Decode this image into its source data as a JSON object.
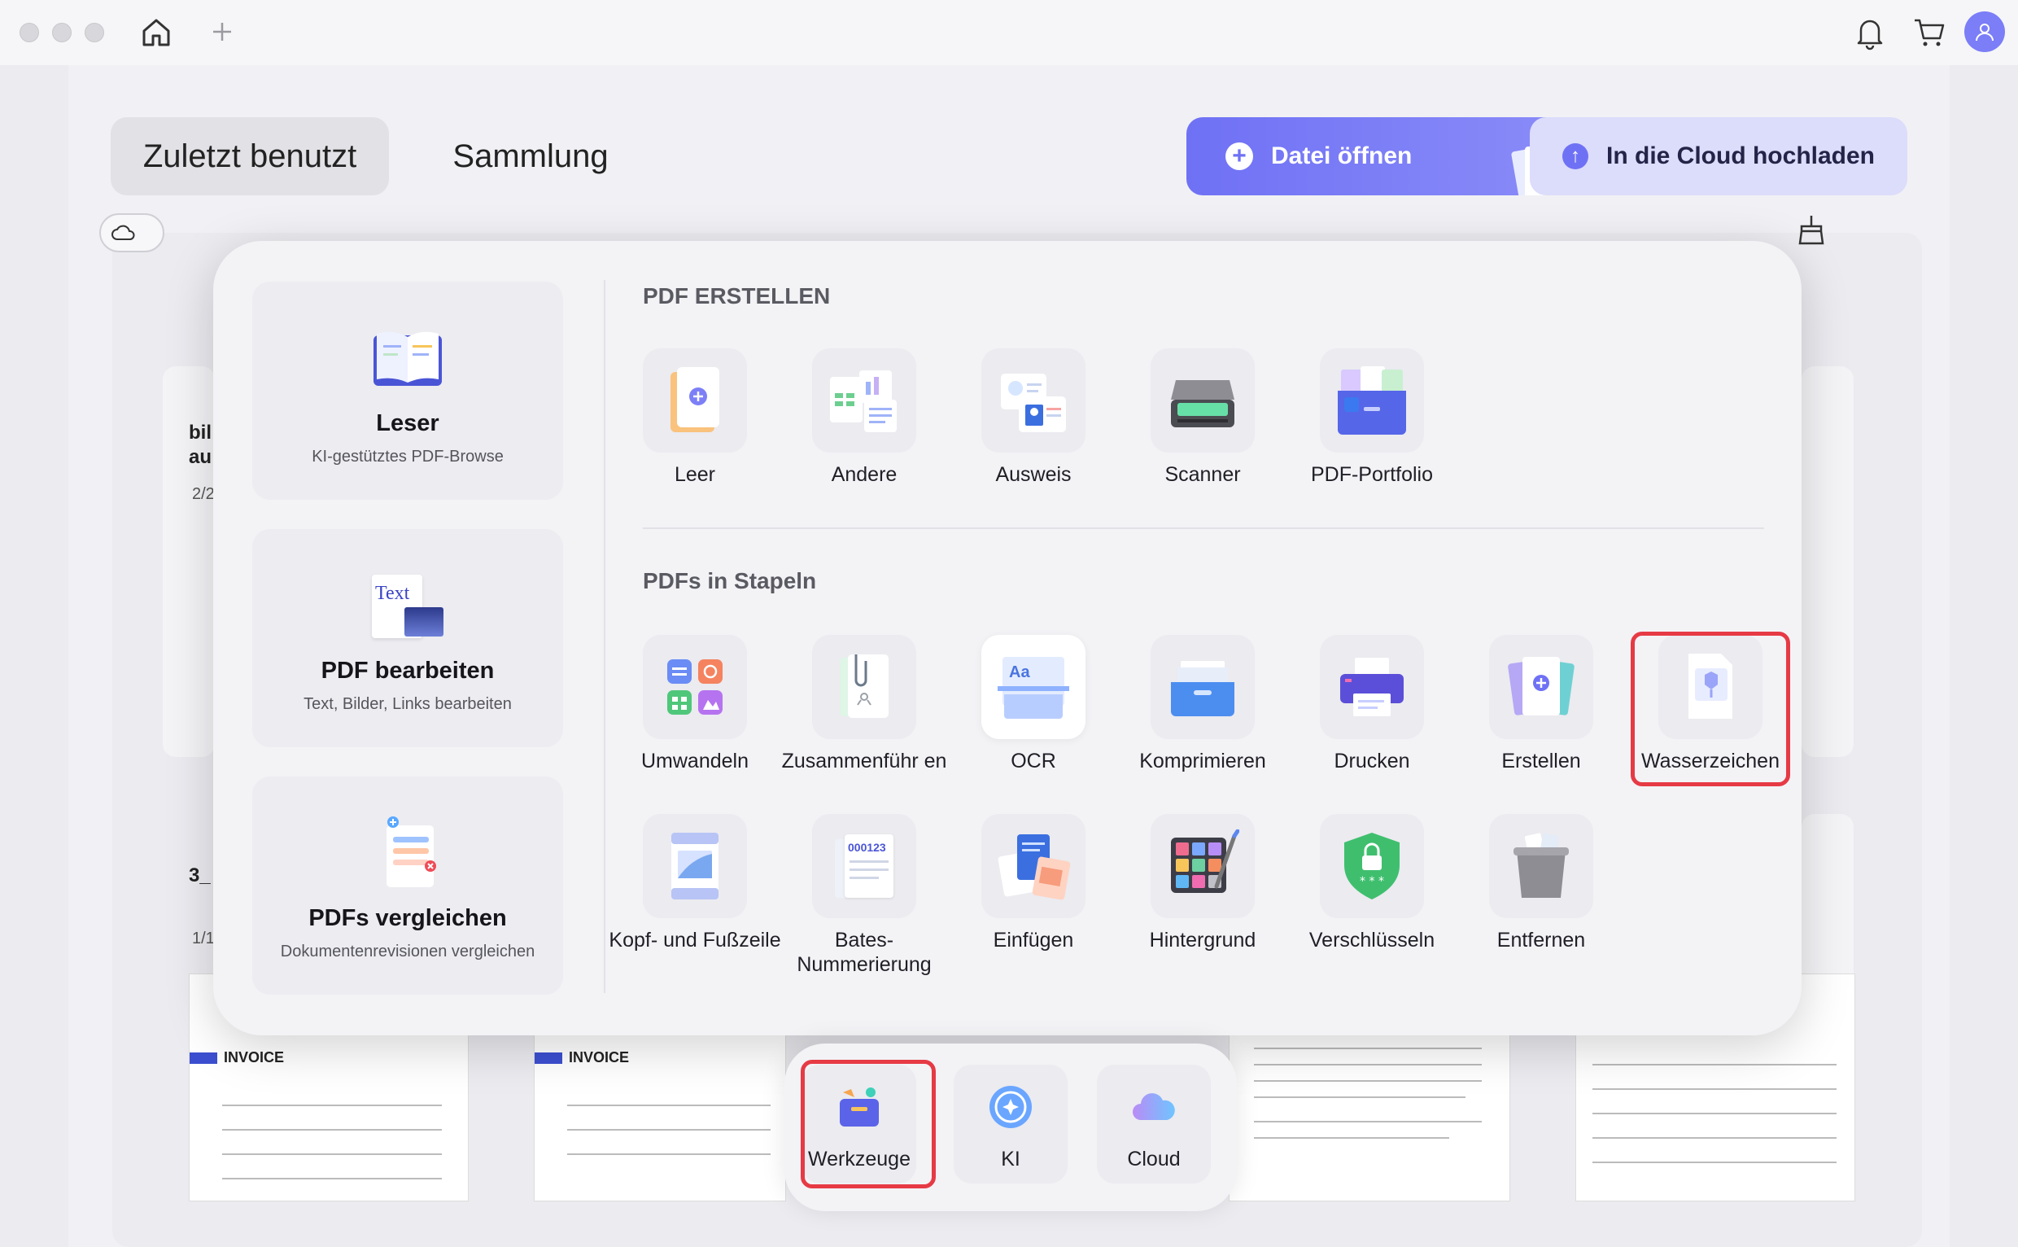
{
  "header": {
    "window_controls": [
      "close",
      "minimize",
      "zoom"
    ],
    "icons": [
      "home-icon",
      "plus-icon",
      "bell-icon",
      "cart-icon",
      "user-avatar-icon"
    ]
  },
  "tabs": [
    {
      "label": "Zuletzt benutzt",
      "active": true
    },
    {
      "label": "Sammlung",
      "active": false
    }
  ],
  "actions": {
    "open_file": "Datei öffnen",
    "upload_cloud": "In die Cloud hochladen"
  },
  "background": {
    "file1_name_a": "bil",
    "file1_name_b": "au",
    "file1_meta": "2/2",
    "file2_name": "3_",
    "file2_meta": "1/1",
    "invoice_title": "INVOICE"
  },
  "popup": {
    "left_cards": [
      {
        "title": "Leser",
        "subtitle": "KI-gestütztes PDF-Browse",
        "icon": "book-icon"
      },
      {
        "title": "PDF bearbeiten",
        "subtitle": "Text, Bilder, Links bearbeiten",
        "icon": "text-edit-icon",
        "icon_text": "Text"
      },
      {
        "title": "PDFs vergleichen",
        "subtitle": "Dokumentenrevisionen vergleichen",
        "icon": "compare-icon"
      }
    ],
    "section_create": "PDF ERSTELLEN",
    "create_tools": [
      "Leer",
      "Andere",
      "Ausweis",
      "Scanner",
      "PDF-Portfolio"
    ],
    "section_batch": "PDFs in Stapeln",
    "batch_tools_row1": [
      "Umwandeln",
      "Zusammenführ en",
      "OCR",
      "Komprimieren",
      "Drucken",
      "Erstellen",
      "Wasserzeichen"
    ],
    "batch_tools_row2": [
      "Kopf- und Fußzeile",
      "Bates-Nummerierung",
      "Einfügen",
      "Hintergrund",
      "Verschlüsseln",
      "Entfernen"
    ],
    "ocr_icon_text": "Aa",
    "bates_icon_text": "000123",
    "highlighted_tool": "Wasserzeichen"
  },
  "dock": {
    "items": [
      "Werkzeuge",
      "KI",
      "Cloud"
    ],
    "highlighted": "Werkzeuge"
  },
  "colors": {
    "accent": "#6f71f5",
    "highlight": "#e63a45"
  }
}
